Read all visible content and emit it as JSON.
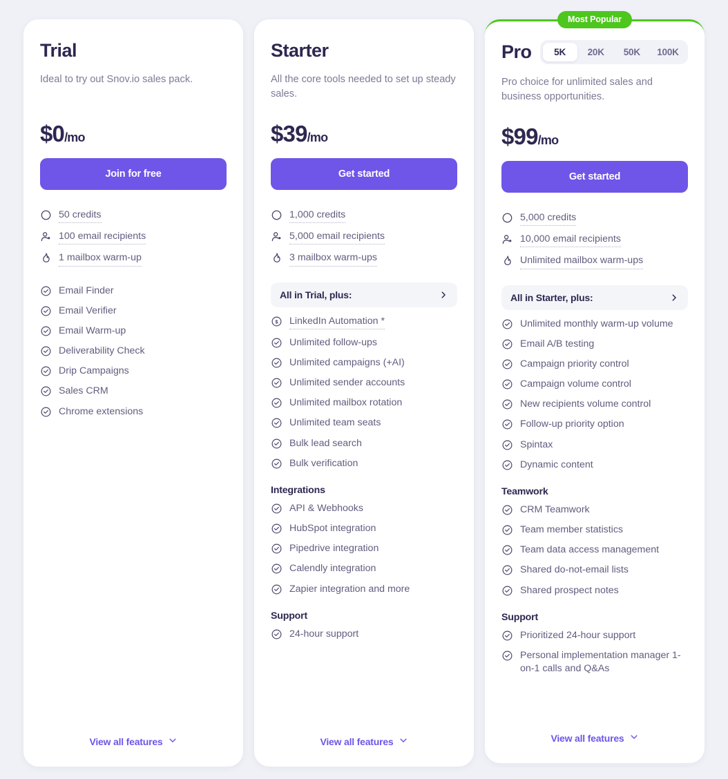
{
  "theme": {
    "page_bg": "#eff1f6",
    "accent_purple": "#6f55e8",
    "badge_green": "#4dc61d",
    "heading_navy": "#2e2750",
    "body_text": "#605d7e"
  },
  "plans": [
    {
      "name": "Trial",
      "description": "Ideal to try out Snov.io sales pack.",
      "price_amount": "$0",
      "price_period": "/mo",
      "cta_label": "Join for free",
      "quotas": [
        {
          "icon": "credits-icon",
          "text": "50 credits",
          "dotted": true
        },
        {
          "icon": "recipients-icon",
          "text": "100 email recipients",
          "dotted": true
        },
        {
          "icon": "flame-icon",
          "text": "1 mailbox warm-up",
          "dotted": true
        }
      ],
      "plus_banner": null,
      "groups": [
        {
          "title": null,
          "features": [
            {
              "icon": "check-circle-icon",
              "text": "Email Finder"
            },
            {
              "icon": "check-circle-icon",
              "text": "Email Verifier"
            },
            {
              "icon": "check-circle-icon",
              "text": "Email Warm-up"
            },
            {
              "icon": "check-circle-icon",
              "text": "Deliverability Check"
            },
            {
              "icon": "check-circle-icon",
              "text": "Drip Campaigns"
            },
            {
              "icon": "check-circle-icon",
              "text": "Sales CRM"
            },
            {
              "icon": "check-circle-icon",
              "text": "Chrome extensions"
            }
          ]
        }
      ],
      "view_all_label": "View all features"
    },
    {
      "name": "Starter",
      "description": "All the core tools needed to set up steady sales.",
      "price_amount": "$39",
      "price_period": "/mo",
      "cta_label": "Get started",
      "quotas": [
        {
          "icon": "credits-icon",
          "text": "1,000 credits",
          "dotted": true
        },
        {
          "icon": "recipients-icon",
          "text": "5,000 email recipients",
          "dotted": true
        },
        {
          "icon": "flame-icon",
          "text": "3 mailbox warm-ups",
          "dotted": true
        }
      ],
      "plus_banner": "All in Trial, plus:",
      "groups": [
        {
          "title": null,
          "features": [
            {
              "icon": "dollar-circle-icon",
              "text": "LinkedIn Automation *",
              "dotted": true
            },
            {
              "icon": "check-circle-icon",
              "text": "Unlimited follow-ups"
            },
            {
              "icon": "check-circle-icon",
              "text": "Unlimited campaigns (+AI)"
            },
            {
              "icon": "check-circle-icon",
              "text": "Unlimited sender accounts"
            },
            {
              "icon": "check-circle-icon",
              "text": "Unlimited mailbox rotation"
            },
            {
              "icon": "check-circle-icon",
              "text": "Unlimited team seats"
            },
            {
              "icon": "check-circle-icon",
              "text": "Bulk lead search"
            },
            {
              "icon": "check-circle-icon",
              "text": "Bulk verification"
            }
          ]
        },
        {
          "title": "Integrations",
          "features": [
            {
              "icon": "check-circle-icon",
              "text": "API & Webhooks"
            },
            {
              "icon": "check-circle-icon",
              "text": "HubSpot integration"
            },
            {
              "icon": "check-circle-icon",
              "text": "Pipedrive integration"
            },
            {
              "icon": "check-circle-icon",
              "text": "Calendly integration"
            },
            {
              "icon": "check-circle-icon",
              "text": "Zapier integration and more"
            }
          ]
        },
        {
          "title": "Support",
          "features": [
            {
              "icon": "check-circle-icon",
              "text": "24-hour support"
            }
          ]
        }
      ],
      "view_all_label": "View all features"
    },
    {
      "name": "Pro",
      "badge": "Most Popular",
      "tiers": [
        "5K",
        "20K",
        "50K",
        "100K"
      ],
      "active_tier": "5K",
      "description": "Pro choice for unlimited sales and business opportunities.",
      "price_amount": "$99",
      "price_period": "/mo",
      "cta_label": "Get started",
      "quotas": [
        {
          "icon": "credits-icon",
          "text": "5,000 credits",
          "dotted": true
        },
        {
          "icon": "recipients-icon",
          "text": "10,000 email recipients",
          "dotted": true
        },
        {
          "icon": "flame-icon",
          "text": "Unlimited mailbox warm-ups",
          "dotted": true
        }
      ],
      "plus_banner": "All in Starter, plus:",
      "groups": [
        {
          "title": null,
          "features": [
            {
              "icon": "check-circle-icon",
              "text": "Unlimited monthly warm-up volume"
            },
            {
              "icon": "check-circle-icon",
              "text": "Email A/B testing"
            },
            {
              "icon": "check-circle-icon",
              "text": "Campaign priority control"
            },
            {
              "icon": "check-circle-icon",
              "text": "Campaign volume control"
            },
            {
              "icon": "check-circle-icon",
              "text": "New recipients volume control"
            },
            {
              "icon": "check-circle-icon",
              "text": "Follow-up priority option"
            },
            {
              "icon": "check-circle-icon",
              "text": "Spintax"
            },
            {
              "icon": "check-circle-icon",
              "text": "Dynamic content"
            }
          ]
        },
        {
          "title": "Teamwork",
          "features": [
            {
              "icon": "check-circle-icon",
              "text": "CRM Teamwork"
            },
            {
              "icon": "check-circle-icon",
              "text": "Team member statistics"
            },
            {
              "icon": "check-circle-icon",
              "text": "Team data access management"
            },
            {
              "icon": "check-circle-icon",
              "text": "Shared do-not-email lists"
            },
            {
              "icon": "check-circle-icon",
              "text": "Shared prospect notes"
            }
          ]
        },
        {
          "title": "Support",
          "features": [
            {
              "icon": "check-circle-icon",
              "text": "Prioritized 24-hour support"
            },
            {
              "icon": "check-circle-icon",
              "text": "Personal implementation manager 1-on-1 calls and Q&As"
            }
          ]
        }
      ],
      "view_all_label": "View all features"
    }
  ]
}
